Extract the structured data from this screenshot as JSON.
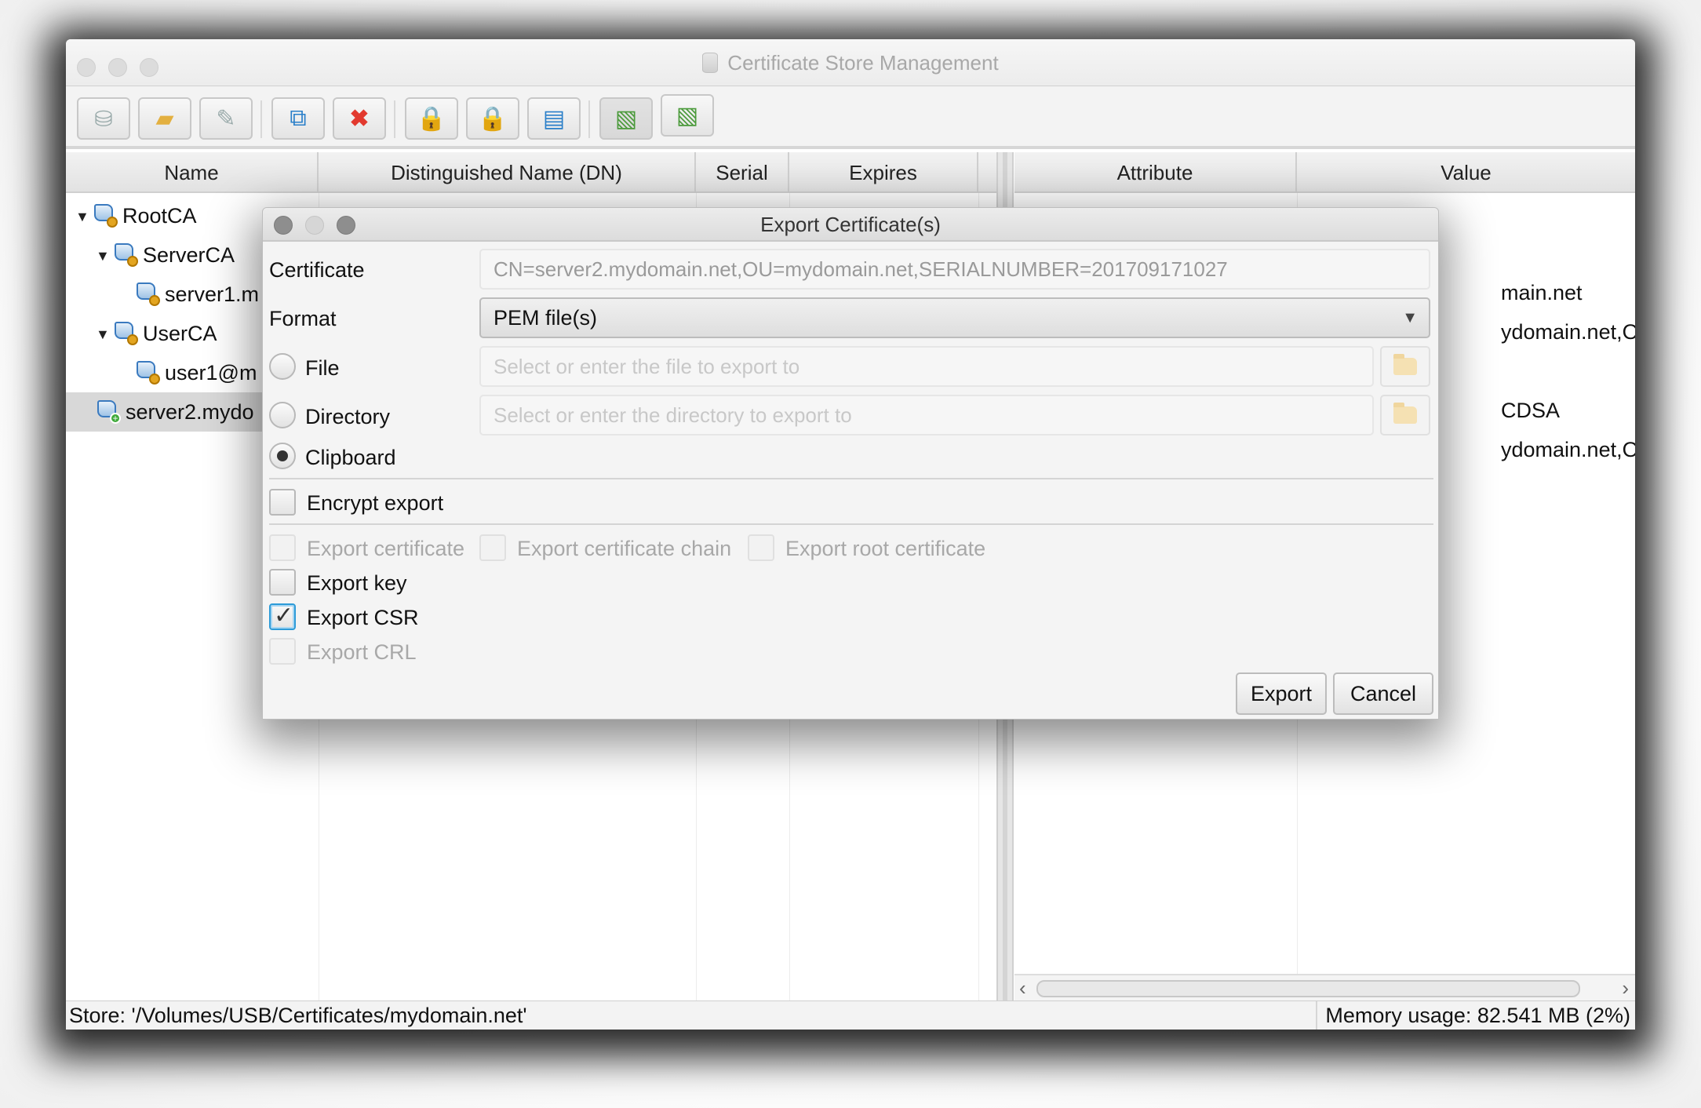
{
  "window": {
    "title": "Certificate Store Management",
    "title_icon": "database-icon"
  },
  "toolbar": {
    "buttons": [
      {
        "name": "new-store-button",
        "icon": "database-add-icon",
        "glyph": "🛢"
      },
      {
        "name": "open-store-button",
        "icon": "folder-database-icon",
        "glyph": "📂"
      },
      {
        "name": "edit-store-button",
        "icon": "database-edit-icon",
        "glyph": "✎"
      },
      {
        "name": "copy-button",
        "icon": "copy-icon",
        "glyph": "⧉"
      },
      {
        "name": "delete-button",
        "icon": "delete-icon",
        "glyph": "✖"
      },
      {
        "name": "add-key-button",
        "icon": "lock-add-icon",
        "glyph": "🔒"
      },
      {
        "name": "remove-key-button",
        "icon": "lock-remove-icon",
        "glyph": "🔒"
      },
      {
        "name": "revoke-button",
        "icon": "certificate-remove-icon",
        "glyph": "📜"
      },
      {
        "name": "import-button",
        "icon": "import-icon",
        "glyph": "⤓"
      },
      {
        "name": "export-button",
        "icon": "export-icon",
        "glyph": "⤒"
      }
    ]
  },
  "left_table": {
    "columns": [
      "Name",
      "Distinguished Name (DN)",
      "Serial",
      "Expires"
    ],
    "rows": [
      {
        "name": "RootCA",
        "expanded": true,
        "level": 0
      },
      {
        "name": "ServerCA",
        "expanded": true,
        "level": 1
      },
      {
        "name": "server1.m",
        "level": 2
      },
      {
        "name": "UserCA",
        "expanded": true,
        "level": 1
      },
      {
        "name": "user1@m",
        "level": 2
      },
      {
        "name": "server2.mydo",
        "level": 0,
        "selected": true
      }
    ]
  },
  "right_table": {
    "columns": [
      "Attribute",
      "Value"
    ],
    "visible_values": [
      "main.net",
      "ydomain.net,OU=m",
      "CDSA",
      "ydomain.net,OU=m"
    ]
  },
  "status": {
    "store": "Store: '/Volumes/USB/Certificates/mydomain.net'",
    "memory": "Memory usage: 82.541 MB (2%)"
  },
  "dialog": {
    "title": "Export Certificate(s)",
    "certificate_label": "Certificate",
    "certificate_value": "CN=server2.mydomain.net,OU=mydomain.net,SERIALNUMBER=201709171027",
    "format_label": "Format",
    "format_value": "PEM file(s)",
    "target": {
      "file_label": "File",
      "file_placeholder": "Select or enter the file to export to",
      "directory_label": "Directory",
      "directory_placeholder": "Select or enter the directory to export to",
      "clipboard_label": "Clipboard",
      "selected": "Clipboard"
    },
    "encrypt_label": "Encrypt export",
    "encrypt_checked": false,
    "options": {
      "export_certificate": {
        "label": "Export certificate",
        "checked": false,
        "enabled": false
      },
      "export_chain": {
        "label": "Export certificate chain",
        "checked": false,
        "enabled": false
      },
      "export_root": {
        "label": "Export root certificate",
        "checked": false,
        "enabled": false
      },
      "export_key": {
        "label": "Export key",
        "checked": false,
        "enabled": true
      },
      "export_csr": {
        "label": "Export CSR",
        "checked": true,
        "enabled": true
      },
      "export_crl": {
        "label": "Export CRL",
        "checked": false,
        "enabled": false
      }
    },
    "export_button": "Export",
    "cancel_button": "Cancel"
  },
  "colors": {
    "focus_accent": "#2d9bd8",
    "delete_red": "#e2392e",
    "add_green": "#3faa3a"
  }
}
